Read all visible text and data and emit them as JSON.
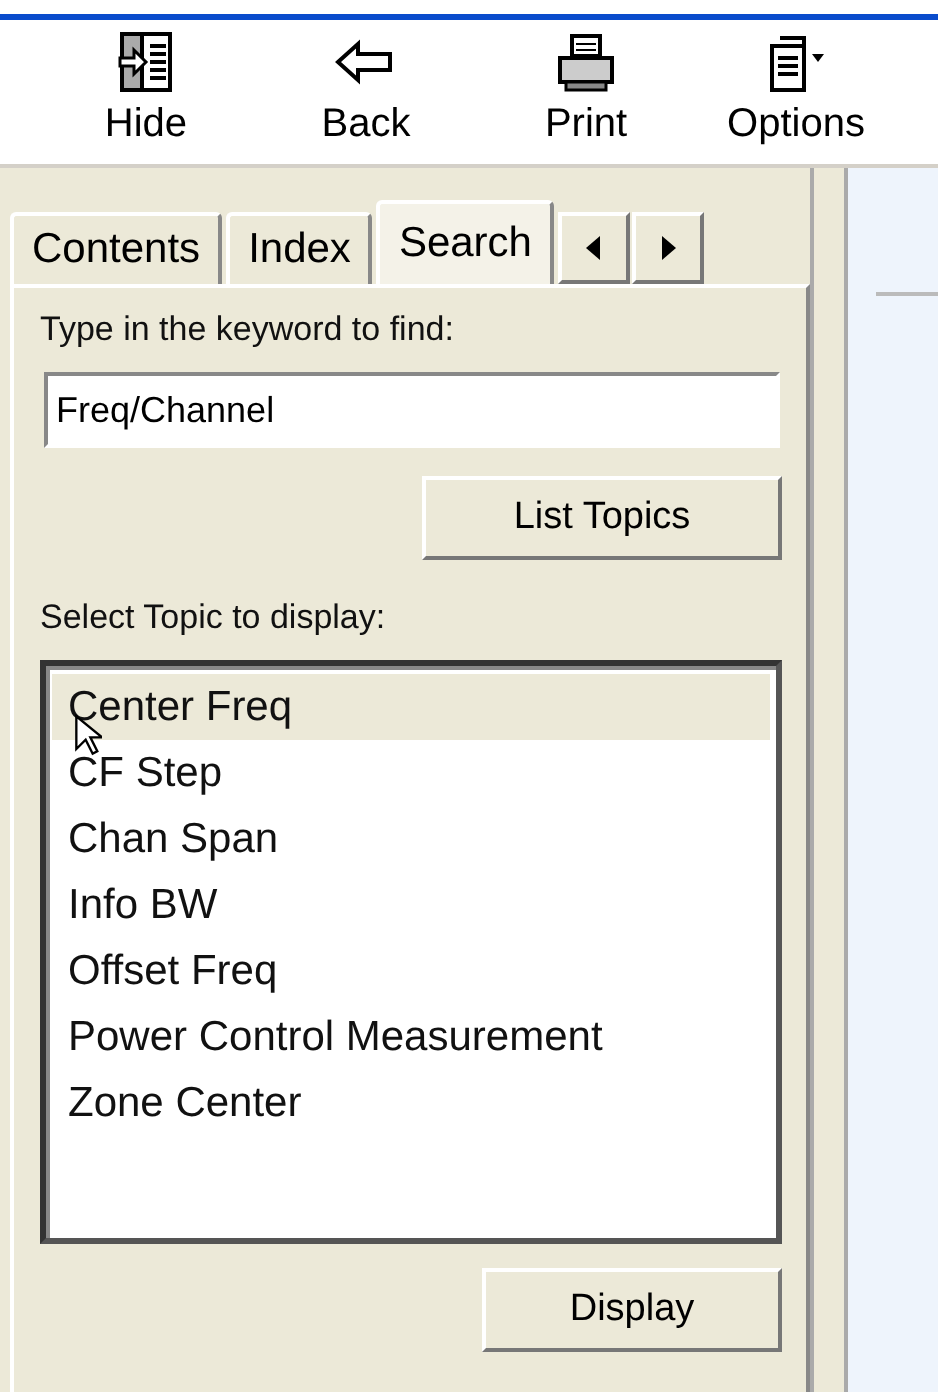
{
  "toolbar": [
    {
      "label": "Hide",
      "kind": "hide"
    },
    {
      "label": "Back",
      "kind": "back"
    },
    {
      "label": "Print",
      "kind": "print"
    },
    {
      "label": "Options",
      "kind": "options"
    }
  ],
  "tabs": [
    {
      "label": "Contents",
      "selected": false
    },
    {
      "label": "Index",
      "selected": false
    },
    {
      "label": "Search",
      "selected": true
    }
  ],
  "search": {
    "prompt": "Type in the keyword to find:",
    "value": "Freq/Channel",
    "button": "List Topics"
  },
  "topics": {
    "prompt": "Select Topic to display:",
    "items": [
      {
        "label": "Center Freq",
        "selected": true
      },
      {
        "label": "CF Step",
        "selected": false
      },
      {
        "label": "Chan Span",
        "selected": false
      },
      {
        "label": "Info BW",
        "selected": false
      },
      {
        "label": "Offset Freq",
        "selected": false
      },
      {
        "label": "Power Control Measurement",
        "selected": false
      },
      {
        "label": "Zone Center",
        "selected": false
      }
    ],
    "button": "Display"
  }
}
